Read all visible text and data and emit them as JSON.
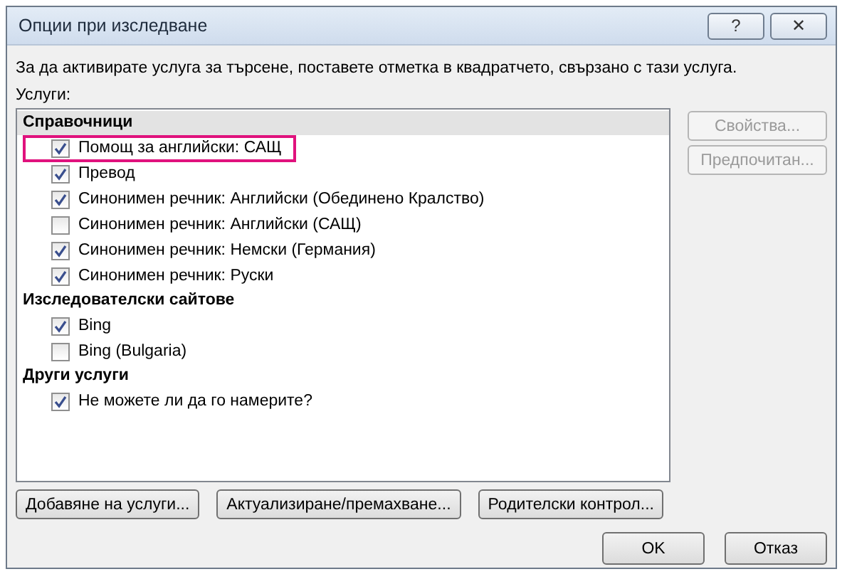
{
  "window": {
    "title": "Опции при изследване",
    "controls": [
      "?",
      "✕"
    ]
  },
  "instruction": "За да активирате услуга за търсене, поставете отметка в квадратчето, свързано с тази услуга.",
  "services_label": "Услуги:",
  "groups": [
    {
      "name": "Справочници",
      "selected": true,
      "items": [
        {
          "label": "Помощ за английски: САЩ",
          "checked": true,
          "highlighted": true
        },
        {
          "label": "Превод",
          "checked": true,
          "highlighted": false
        },
        {
          "label": "Синонимен речник: Английски (Обединено Кралство)",
          "checked": true,
          "highlighted": false
        },
        {
          "label": "Синонимен речник: Английски (САЩ)",
          "checked": false,
          "highlighted": false
        },
        {
          "label": "Синонимен речник: Немски (Германия)",
          "checked": true,
          "highlighted": false
        },
        {
          "label": "Синонимен речник: Руски",
          "checked": true,
          "highlighted": false
        }
      ]
    },
    {
      "name": "Изследователски сайтове",
      "selected": false,
      "items": [
        {
          "label": "Bing",
          "checked": true,
          "highlighted": false
        },
        {
          "label": "Bing (Bulgaria)",
          "checked": false,
          "highlighted": false
        }
      ]
    },
    {
      "name": "Други услуги",
      "selected": false,
      "items": [
        {
          "label": "Не можете ли да го намерите?",
          "checked": true,
          "highlighted": false
        }
      ]
    }
  ],
  "side_buttons": [
    {
      "label": "Свойства...",
      "disabled": true
    },
    {
      "label": "Предпочитан...",
      "disabled": true
    }
  ],
  "action_buttons": [
    "Добавяне на услуги...",
    "Актуализиране/премахване...",
    "Родителски контрол..."
  ],
  "dialog_buttons": [
    "OK",
    "Отказ"
  ]
}
